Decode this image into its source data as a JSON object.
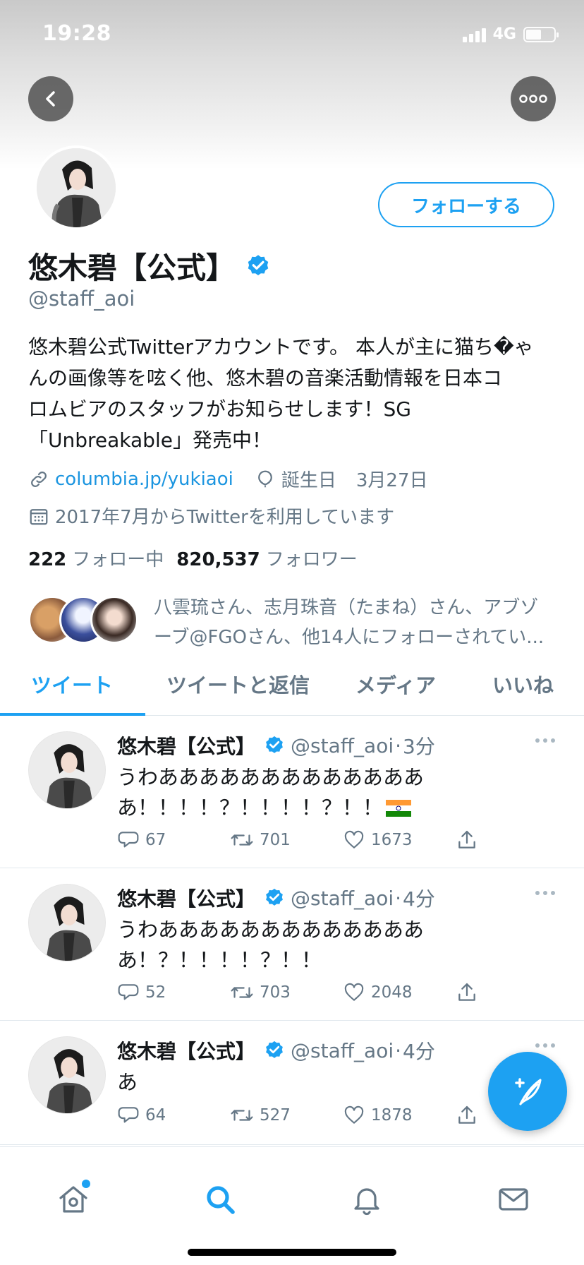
{
  "status_bar": {
    "time": "19:28",
    "network": "4G"
  },
  "profile": {
    "display_name": "悠木碧【公式】",
    "handle": "@staff_aoi",
    "follow_label": "フォローする",
    "bio_lines": [
      "悠木碧公式Twitterアカウントです。 本人が主に猫ち�ゃ",
      "んの画像等を呟く他、悠木碧の音楽活動情報を日本コ",
      "ロムビアのスタッフがお知らせします！SG",
      "「Unbreakable」発売中！"
    ],
    "link": "columbia.jp/yukiaoi",
    "birthday_label": "誕生日",
    "birthday": "3月27日",
    "joined": "2017年7月からTwitterを利用しています",
    "following_count": "222",
    "following_label": "フォロー中",
    "followers_count": "820,537",
    "followers_label": "フォロワー",
    "known_followers_line1": "八雲琉さん、志月珠音（たまね）さん、アブゾ",
    "known_followers_line2": "ーブ@FGOさん、他14人にフォローされてい..."
  },
  "tabs": [
    {
      "label": "ツイート"
    },
    {
      "label": "ツイートと返信"
    },
    {
      "label": "メディア"
    },
    {
      "label": "いいね"
    }
  ],
  "tweets": [
    {
      "name": "悠木碧【公式】",
      "handle": "@staff_aoi",
      "sep": "·",
      "time": "3分",
      "line1": "うわあああああああああああああ",
      "line2": "あ！！！！？！！！！？！！",
      "replies": "67",
      "retweets": "701",
      "likes": "1673"
    },
    {
      "name": "悠木碧【公式】",
      "handle": "@staff_aoi",
      "sep": "·",
      "time": "4分",
      "line1": "うわあああああああああああああ",
      "line2": "あ！？！！！！？！！",
      "replies": "52",
      "retweets": "703",
      "likes": "2048"
    },
    {
      "name": "悠木碧【公式】",
      "handle": "@staff_aoi",
      "sep": "·",
      "time": "4分",
      "line1": "あ",
      "line2": "",
      "replies": "64",
      "retweets": "527",
      "likes": "1878"
    }
  ],
  "colors": {
    "accent": "#1da1f2",
    "muted": "#657786",
    "text": "#14171a"
  },
  "icons": [
    "back-icon",
    "more-icon",
    "verified-icon",
    "link-icon",
    "balloon-icon",
    "calendar-icon",
    "reply-icon",
    "retweet-icon",
    "like-icon",
    "share-icon",
    "compose-icon",
    "home-icon",
    "search-icon",
    "bell-icon",
    "mail-icon"
  ]
}
